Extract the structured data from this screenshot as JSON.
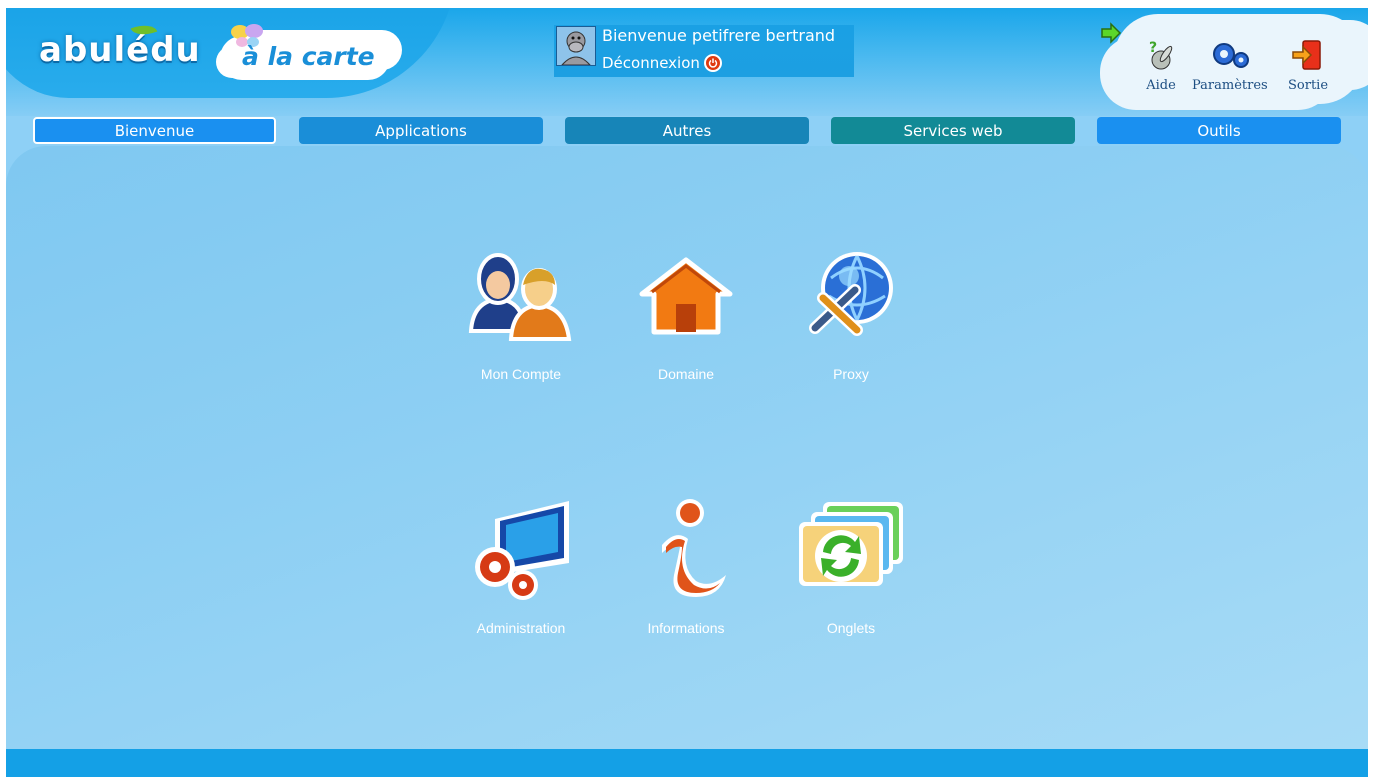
{
  "header": {
    "logo_text": "abulédu",
    "sublogo_text": "à la carte",
    "welcome": "Bienvenue petifrere bertrand",
    "logout_label": "Déconnexion"
  },
  "toolbar": {
    "help_label": "Aide",
    "settings_label": "Paramètres",
    "exit_label": "Sortie"
  },
  "tabs": [
    {
      "label": "Bienvenue",
      "color": "#1a90f0",
      "active": true
    },
    {
      "label": "Applications",
      "color": "#1a8ed8"
    },
    {
      "label": "Autres",
      "color": "#1785b8"
    },
    {
      "label": "Services web",
      "color": "#128a96"
    },
    {
      "label": "Outils",
      "color": "#1a90f0"
    }
  ],
  "apps": [
    {
      "label": "Mon Compte",
      "icon": "users-icon"
    },
    {
      "label": "Domaine",
      "icon": "house-icon"
    },
    {
      "label": "Proxy",
      "icon": "globe-tools-icon"
    },
    {
      "label": "Administration",
      "icon": "monitor-gears-icon"
    },
    {
      "label": "Informations",
      "icon": "info-icon"
    },
    {
      "label": "Onglets",
      "icon": "refresh-tabs-icon"
    }
  ],
  "colors": {
    "header_blue": "#1aa6ea",
    "page_blue": "#8dcff3",
    "footer_blue": "#14a0e6"
  }
}
